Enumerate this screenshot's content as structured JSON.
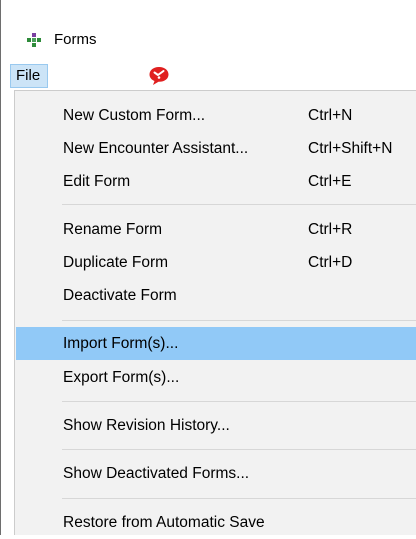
{
  "window": {
    "title": "Forms"
  },
  "menubar": {
    "file_label": "File"
  },
  "menu": {
    "items": [
      {
        "label": "New Custom Form...",
        "shortcut": "Ctrl+N"
      },
      {
        "label": "New Encounter Assistant...",
        "shortcut": "Ctrl+Shift+N"
      },
      {
        "label": "Edit Form",
        "shortcut": "Ctrl+E"
      },
      {
        "label": "Rename Form",
        "shortcut": "Ctrl+R"
      },
      {
        "label": "Duplicate Form",
        "shortcut": "Ctrl+D"
      },
      {
        "label": "Deactivate Form",
        "shortcut": ""
      },
      {
        "label": "Import Form(s)...",
        "shortcut": "",
        "highlighted": true
      },
      {
        "label": "Export Form(s)...",
        "shortcut": ""
      },
      {
        "label": "Show Revision History...",
        "shortcut": ""
      },
      {
        "label": "Show Deactivated Forms...",
        "shortcut": ""
      },
      {
        "label": "Restore from Automatic Save",
        "shortcut": ""
      }
    ]
  },
  "colors": {
    "highlight": "#91c9f7",
    "menu_background": "#f2f2f2",
    "file_menu_active": "#cce4f7",
    "alert_red": "#e02020",
    "app_icon_green": "#2e8b3a",
    "app_icon_purple": "#7a3fa0"
  },
  "icons": {
    "app": "forms-app-icon",
    "alert": "speech-bubble-alert-icon"
  }
}
